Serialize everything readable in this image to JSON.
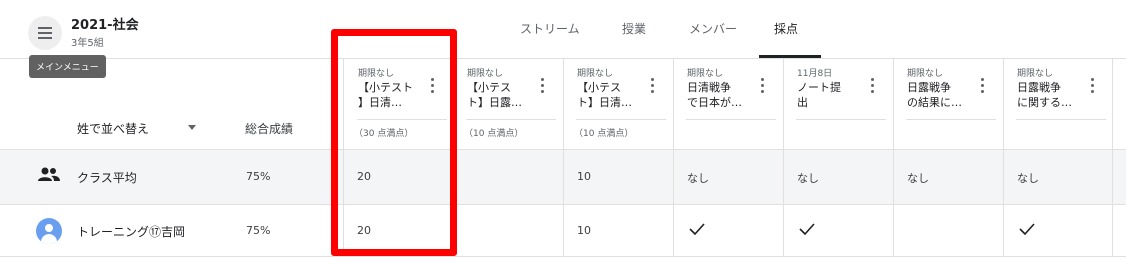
{
  "header": {
    "class_title": "2021-社会",
    "class_subtitle": "3年5組",
    "tooltip": "メインメニュー",
    "tabs": [
      "ストリーム",
      "授業",
      "メンバー",
      "採点"
    ],
    "active_tab": "採点"
  },
  "grid": {
    "sort_label": "姓で並べ替え",
    "overall_label": "総合成績",
    "assignments": [
      {
        "due": "期限なし",
        "title_lines": [
          "【小テスト",
          "】日清…"
        ],
        "points": "（30 点満点）"
      },
      {
        "due": "期限なし",
        "title_lines": [
          "【小テス",
          "ト】日露…"
        ],
        "points": "（10 点満点）"
      },
      {
        "due": "期限なし",
        "title_lines": [
          "【小テス",
          "ト】日清…"
        ],
        "points": "（10 点満点）"
      },
      {
        "due": "期限なし",
        "title_lines": [
          "日清戦争",
          "で日本が…"
        ],
        "points": ""
      },
      {
        "due": "11月8日",
        "title_lines": [
          "ノート提",
          "出"
        ],
        "points": ""
      },
      {
        "due": "期限なし",
        "title_lines": [
          "日露戦争",
          "の結果に…"
        ],
        "points": ""
      },
      {
        "due": "期限なし",
        "title_lines": [
          "日露戦争",
          "に関する…"
        ],
        "points": ""
      }
    ],
    "rows": [
      {
        "name": "クラス平均",
        "overall": "75%",
        "cells": [
          "20",
          "",
          "10",
          "なし",
          "なし",
          "なし",
          "なし"
        ]
      },
      {
        "name": "トレーニング⑰吉岡",
        "overall": "75%",
        "cells": [
          "20",
          "",
          "10",
          "check",
          "check",
          "",
          "check"
        ]
      }
    ]
  },
  "colors": {
    "highlight": "#ff0000",
    "avatar": "#6a9ff0"
  }
}
